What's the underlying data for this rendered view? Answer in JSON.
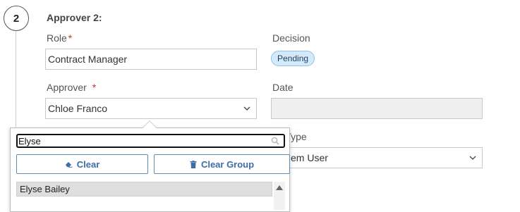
{
  "step": {
    "number": "2"
  },
  "approver_section": {
    "heading": "Approver 2:",
    "role": {
      "label": "Role",
      "required_mark": "*",
      "value": "Contract Manager"
    },
    "decision": {
      "label": "Decision",
      "status": "Pending"
    },
    "approver": {
      "label": "Approver",
      "required_mark": "*",
      "value": "Chloe Franco"
    },
    "date": {
      "label": "Date",
      "value": ""
    },
    "type": {
      "label_visible_part": "r Type",
      "value_visible_part": "em User"
    }
  },
  "dropdown": {
    "search": {
      "value": "Elyse",
      "placeholder": ""
    },
    "clear_label": "Clear",
    "clear_group_label": "Clear Group",
    "options": [
      "Elyse Bailey"
    ]
  },
  "colors": {
    "accent": "#3c6fa6",
    "required": "#c0392b",
    "pending_badge_bg": "#d4eafb",
    "pending_badge_border": "#8cc3ea"
  },
  "icons": {
    "search": "magnifier-icon",
    "clear": "eraser-icon",
    "clear_group": "trash-icon",
    "select": "chevron-down-icon",
    "scroll": "scroll-up-arrow-icon"
  }
}
